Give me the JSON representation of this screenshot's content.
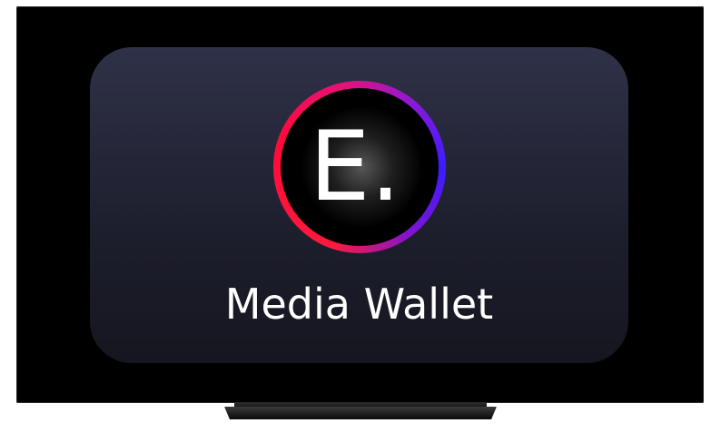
{
  "app": {
    "logo_letter": "E.",
    "title": "Media Wallet"
  },
  "colors": {
    "ring_start": "#ff1a3c",
    "ring_end": "#3b1cff",
    "card_top": "#2f3148",
    "card_bottom": "#15161f"
  },
  "icons": {
    "logo": "circle-gradient-logo-icon"
  }
}
